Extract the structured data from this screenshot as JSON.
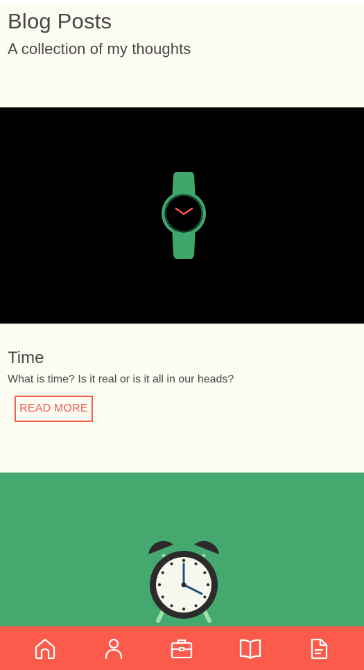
{
  "header": {
    "title": "Blog Posts",
    "subtitle": "A collection of my thoughts"
  },
  "posts": [
    {
      "image_icon": "wristwatch-illustration",
      "image_bg": "#000000",
      "title": "Time",
      "excerpt": "What is time? Is it real or is it all in our heads?",
      "button_label": "READ MORE"
    },
    {
      "image_icon": "alarm-clock-illustration",
      "image_bg": "#45a86f"
    }
  ],
  "bottom_nav": {
    "background": "#fc5a4a",
    "items": [
      {
        "icon": "home-icon"
      },
      {
        "icon": "user-icon"
      },
      {
        "icon": "briefcase-icon"
      },
      {
        "icon": "book-icon"
      },
      {
        "icon": "document-icon"
      }
    ]
  },
  "colors": {
    "page_bg": "#fcfcf3",
    "text": "#4a4645",
    "accent": "#f25a4a",
    "watch_green": "#3fa76c"
  }
}
